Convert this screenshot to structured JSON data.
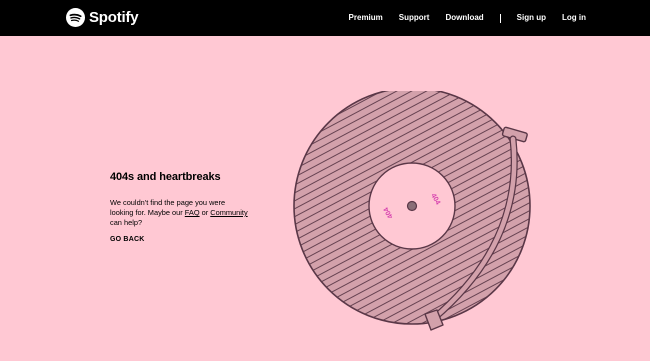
{
  "header": {
    "brand": "Spotify",
    "nav": {
      "premium": "Premium",
      "support": "Support",
      "download": "Download",
      "signup": "Sign up",
      "login": "Log in"
    }
  },
  "error": {
    "title": "404s and heartbreaks",
    "message_part1": "We couldn't find the page you were looking for. Maybe our ",
    "faq_link": "FAQ",
    "message_part2": " or ",
    "community_link": "Community",
    "message_part3": " can help?",
    "go_back": "GO BACK"
  },
  "record": {
    "label_text": "404"
  },
  "colors": {
    "header_bg": "#000000",
    "page_bg": "#ffc8d3",
    "record_fill": "#d3a1ab",
    "record_stroke": "#5a3747",
    "label_fill": "#ffc8d3",
    "label_text": "#d63fae"
  }
}
